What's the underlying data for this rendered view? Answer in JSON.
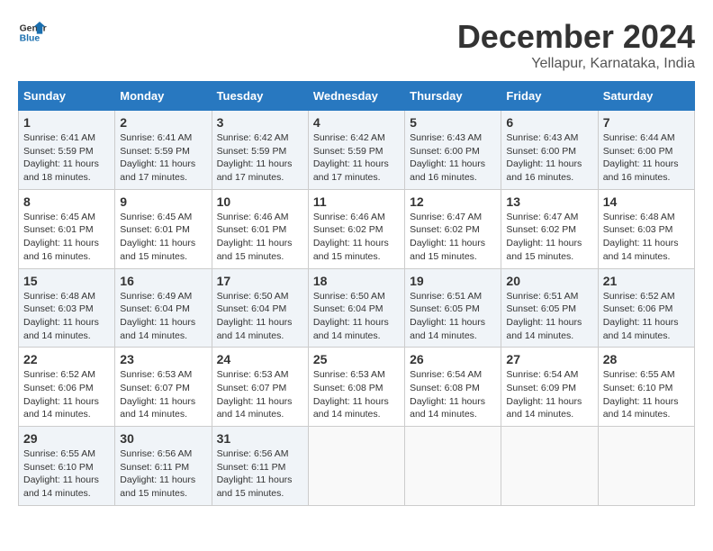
{
  "logo": {
    "text1": "General",
    "text2": "Blue"
  },
  "title": "December 2024",
  "location": "Yellapur, Karnataka, India",
  "days_of_week": [
    "Sunday",
    "Monday",
    "Tuesday",
    "Wednesday",
    "Thursday",
    "Friday",
    "Saturday"
  ],
  "weeks": [
    [
      {
        "day": "1",
        "sunrise": "6:41 AM",
        "sunset": "5:59 PM",
        "daylight": "11 hours and 18 minutes."
      },
      {
        "day": "2",
        "sunrise": "6:41 AM",
        "sunset": "5:59 PM",
        "daylight": "11 hours and 17 minutes."
      },
      {
        "day": "3",
        "sunrise": "6:42 AM",
        "sunset": "5:59 PM",
        "daylight": "11 hours and 17 minutes."
      },
      {
        "day": "4",
        "sunrise": "6:42 AM",
        "sunset": "5:59 PM",
        "daylight": "11 hours and 17 minutes."
      },
      {
        "day": "5",
        "sunrise": "6:43 AM",
        "sunset": "6:00 PM",
        "daylight": "11 hours and 16 minutes."
      },
      {
        "day": "6",
        "sunrise": "6:43 AM",
        "sunset": "6:00 PM",
        "daylight": "11 hours and 16 minutes."
      },
      {
        "day": "7",
        "sunrise": "6:44 AM",
        "sunset": "6:00 PM",
        "daylight": "11 hours and 16 minutes."
      }
    ],
    [
      {
        "day": "8",
        "sunrise": "6:45 AM",
        "sunset": "6:01 PM",
        "daylight": "11 hours and 16 minutes."
      },
      {
        "day": "9",
        "sunrise": "6:45 AM",
        "sunset": "6:01 PM",
        "daylight": "11 hours and 15 minutes."
      },
      {
        "day": "10",
        "sunrise": "6:46 AM",
        "sunset": "6:01 PM",
        "daylight": "11 hours and 15 minutes."
      },
      {
        "day": "11",
        "sunrise": "6:46 AM",
        "sunset": "6:02 PM",
        "daylight": "11 hours and 15 minutes."
      },
      {
        "day": "12",
        "sunrise": "6:47 AM",
        "sunset": "6:02 PM",
        "daylight": "11 hours and 15 minutes."
      },
      {
        "day": "13",
        "sunrise": "6:47 AM",
        "sunset": "6:02 PM",
        "daylight": "11 hours and 15 minutes."
      },
      {
        "day": "14",
        "sunrise": "6:48 AM",
        "sunset": "6:03 PM",
        "daylight": "11 hours and 14 minutes."
      }
    ],
    [
      {
        "day": "15",
        "sunrise": "6:48 AM",
        "sunset": "6:03 PM",
        "daylight": "11 hours and 14 minutes."
      },
      {
        "day": "16",
        "sunrise": "6:49 AM",
        "sunset": "6:04 PM",
        "daylight": "11 hours and 14 minutes."
      },
      {
        "day": "17",
        "sunrise": "6:50 AM",
        "sunset": "6:04 PM",
        "daylight": "11 hours and 14 minutes."
      },
      {
        "day": "18",
        "sunrise": "6:50 AM",
        "sunset": "6:04 PM",
        "daylight": "11 hours and 14 minutes."
      },
      {
        "day": "19",
        "sunrise": "6:51 AM",
        "sunset": "6:05 PM",
        "daylight": "11 hours and 14 minutes."
      },
      {
        "day": "20",
        "sunrise": "6:51 AM",
        "sunset": "6:05 PM",
        "daylight": "11 hours and 14 minutes."
      },
      {
        "day": "21",
        "sunrise": "6:52 AM",
        "sunset": "6:06 PM",
        "daylight": "11 hours and 14 minutes."
      }
    ],
    [
      {
        "day": "22",
        "sunrise": "6:52 AM",
        "sunset": "6:06 PM",
        "daylight": "11 hours and 14 minutes."
      },
      {
        "day": "23",
        "sunrise": "6:53 AM",
        "sunset": "6:07 PM",
        "daylight": "11 hours and 14 minutes."
      },
      {
        "day": "24",
        "sunrise": "6:53 AM",
        "sunset": "6:07 PM",
        "daylight": "11 hours and 14 minutes."
      },
      {
        "day": "25",
        "sunrise": "6:53 AM",
        "sunset": "6:08 PM",
        "daylight": "11 hours and 14 minutes."
      },
      {
        "day": "26",
        "sunrise": "6:54 AM",
        "sunset": "6:08 PM",
        "daylight": "11 hours and 14 minutes."
      },
      {
        "day": "27",
        "sunrise": "6:54 AM",
        "sunset": "6:09 PM",
        "daylight": "11 hours and 14 minutes."
      },
      {
        "day": "28",
        "sunrise": "6:55 AM",
        "sunset": "6:10 PM",
        "daylight": "11 hours and 14 minutes."
      }
    ],
    [
      {
        "day": "29",
        "sunrise": "6:55 AM",
        "sunset": "6:10 PM",
        "daylight": "11 hours and 14 minutes."
      },
      {
        "day": "30",
        "sunrise": "6:56 AM",
        "sunset": "6:11 PM",
        "daylight": "11 hours and 15 minutes."
      },
      {
        "day": "31",
        "sunrise": "6:56 AM",
        "sunset": "6:11 PM",
        "daylight": "11 hours and 15 minutes."
      },
      null,
      null,
      null,
      null
    ]
  ]
}
